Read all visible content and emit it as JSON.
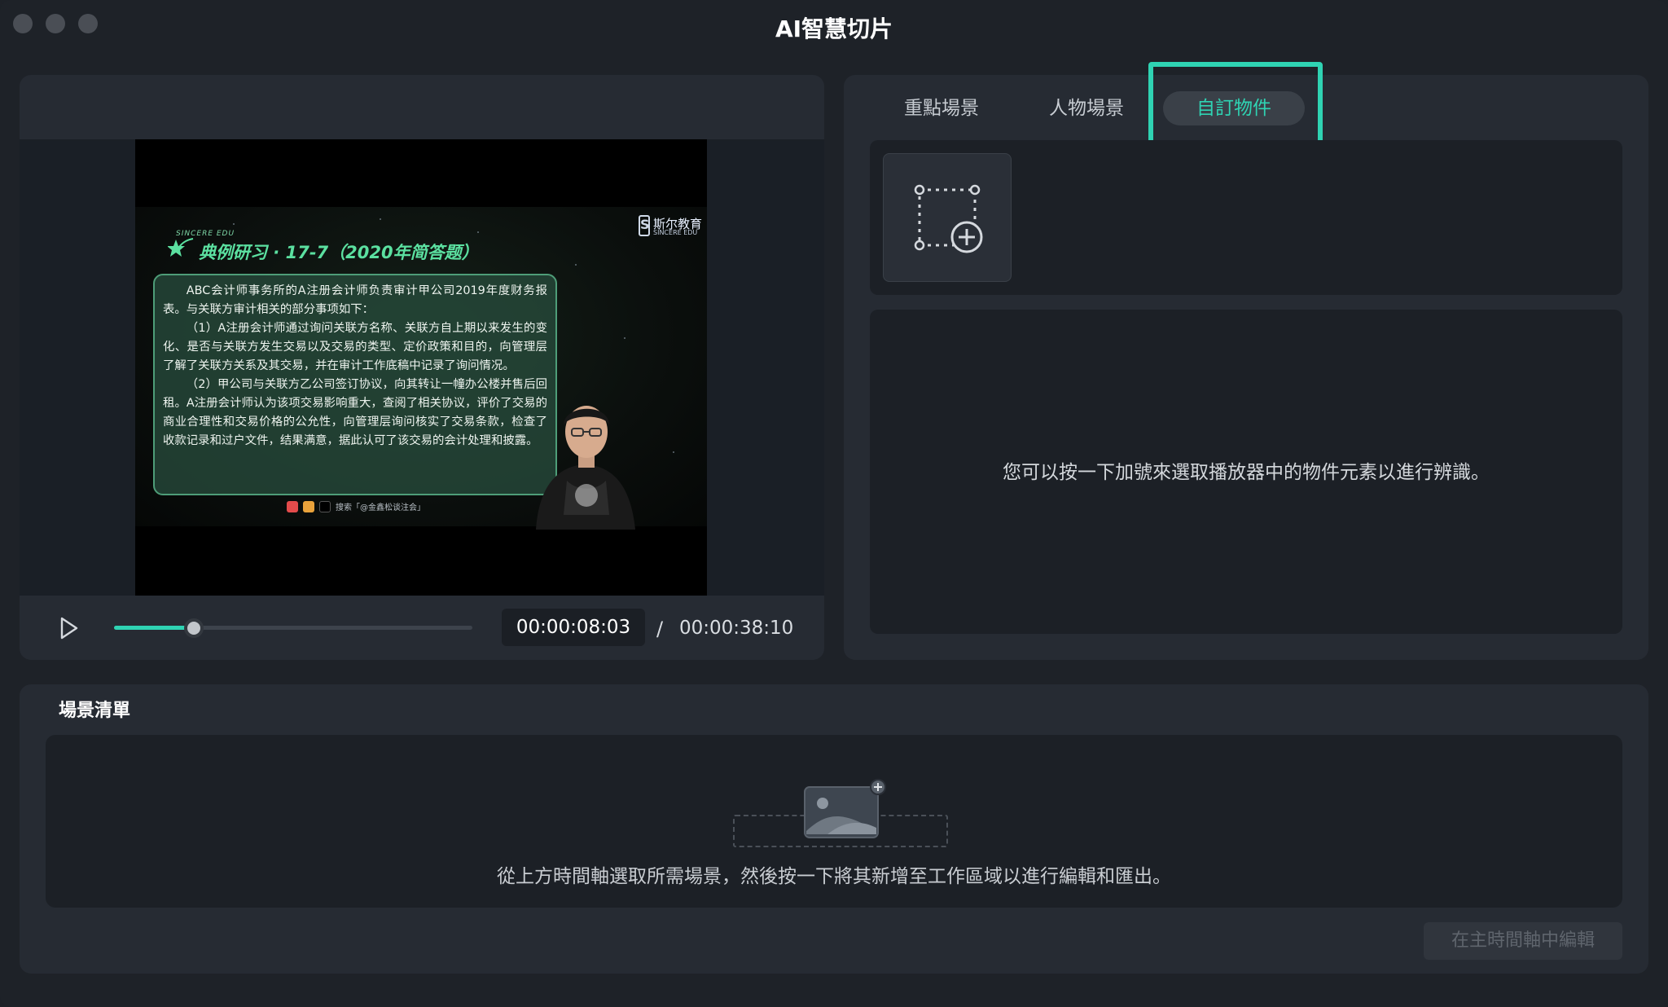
{
  "window": {
    "title": "AI智慧切片"
  },
  "player": {
    "current_time": "00:00:08:03",
    "separator": "/",
    "total_time": "00:00:38:10",
    "progress": 0.22,
    "video": {
      "brand_small": "SINCERE EDU",
      "slide_title": "典例研习 · 17-7（2020年简答题）",
      "logo_cn": "斯尔教育",
      "logo_en": "SINCERE EDU",
      "paragraph_1": "ABC会计师事务所的A注册会计师负责审计甲公司2019年度财务报表。与关联方审计相关的部分事项如下：",
      "paragraph_2": "（1）A注册会计师通过询问关联方名称、关联方自上期以来发生的变化、是否与关联方发生交易以及交易的类型、定价政策和目的，向管理层了解了关联方关系及其交易，并在审计工作底稿中记录了询问情况。",
      "paragraph_3": "（2）甲公司与关联方乙公司签订协议，向其转让一幢办公楼并售后回租。A注册会计师认为该项交易影响重大，查阅了相关协议，评价了交易的商业合理性和交易价格的公允性，向管理层询问核实了交易条款，检查了收款记录和过户文件，结果满意，据此认可了该交易的会计处理和披露。",
      "footer": "搜索「@金鑫松谈注会」"
    }
  },
  "object_panel": {
    "tabs": [
      {
        "label": "重點場景",
        "active": false
      },
      {
        "label": "人物場景",
        "active": false
      },
      {
        "label": "自訂物件",
        "active": true
      }
    ],
    "add_object_icon": "select-region-add-icon",
    "hint": "您可以按一下加號來選取播放器中的物件元素以進行辨識。"
  },
  "scene_list": {
    "title": "場景清單",
    "placeholder_icon": "image-add-icon",
    "hint": "從上方時間軸選取所需場景，然後按一下將其新增至工作區域以進行編輯和匯出。",
    "edit_button": "在主時間軸中編輯"
  },
  "colors": {
    "accent": "#2fd3b3",
    "window_bg": "#1e2228",
    "panel_bg": "#262b33"
  }
}
